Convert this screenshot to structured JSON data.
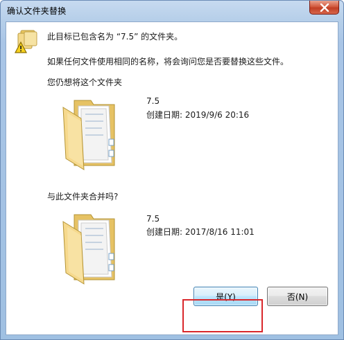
{
  "window": {
    "title": "确认文件夹替换",
    "close_icon": "close-icon"
  },
  "message": {
    "line1": "此目标已包含名为 “7.5” 的文件夹。",
    "line2": "如果任何文件使用相同的名称，将会询问您是否要替换这些文件。",
    "line3": "您仍想将这个文件夹",
    "line4": "与此文件夹合并吗?"
  },
  "source_folder": {
    "name": "7.5",
    "date_text": "创建日期: 2019/9/6 20:16"
  },
  "target_folder": {
    "name": "7.5",
    "date_text": "创建日期: 2017/8/16 11:01"
  },
  "buttons": {
    "yes_label": "是(Y)",
    "no_label": "否(N)"
  },
  "colors": {
    "highlight": "#d9272b",
    "close_button": "#c13f24",
    "folder_yellow": "#f2d37e"
  }
}
